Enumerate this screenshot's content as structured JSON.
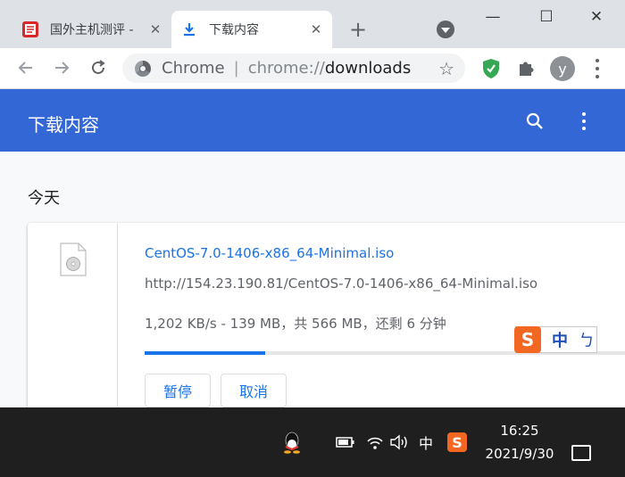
{
  "tabs": [
    {
      "title": "国外主机测评 -",
      "close": "✕",
      "active": false
    },
    {
      "title": "下载内容",
      "close": "✕",
      "active": true
    }
  ],
  "window_controls": {
    "minimize": "—",
    "maximize": "☐",
    "close": "✕"
  },
  "new_tab": "+",
  "omnibox": {
    "site": "Chrome",
    "separator": "|",
    "scheme": "chrome://",
    "path": "downloads"
  },
  "avatar_initial": "y",
  "downloads": {
    "page_title": "下载内容",
    "section_date": "今天",
    "item": {
      "file_name": "CentOS-7.0-1406-x86_64-Minimal.iso",
      "url": "http://154.23.190.81/CentOS-7.0-1406-x86_64-Minimal.iso",
      "status": "1,202 KB/s - 139 MB，共 566 MB，还剩 6 分钟",
      "progress_fraction": 0.2456,
      "pause_label": "暂停",
      "cancel_label": "取消"
    }
  },
  "ime": {
    "logo": "S",
    "mode": "中",
    "punct": "ㄅ"
  },
  "taskbar": {
    "input_method": "中",
    "sogou": "S",
    "time": "16:25",
    "date": "2021/9/30"
  },
  "colors": {
    "accent": "#3367d6",
    "link": "#1a73e8",
    "taskbar": "#1f1f1f",
    "sogou": "#f26722"
  },
  "icons": [
    "sogou-icon",
    "download-icon",
    "plus-icon",
    "chevron-down-icon",
    "back-arrow-icon",
    "forward-arrow-icon",
    "reload-icon",
    "chrome-icon",
    "star-icon",
    "shield-icon",
    "puzzle-icon",
    "kebab-menu-icon",
    "search-icon",
    "file-icon",
    "qq-icon",
    "battery-icon",
    "wifi-icon",
    "volume-icon",
    "notification-icon"
  ]
}
